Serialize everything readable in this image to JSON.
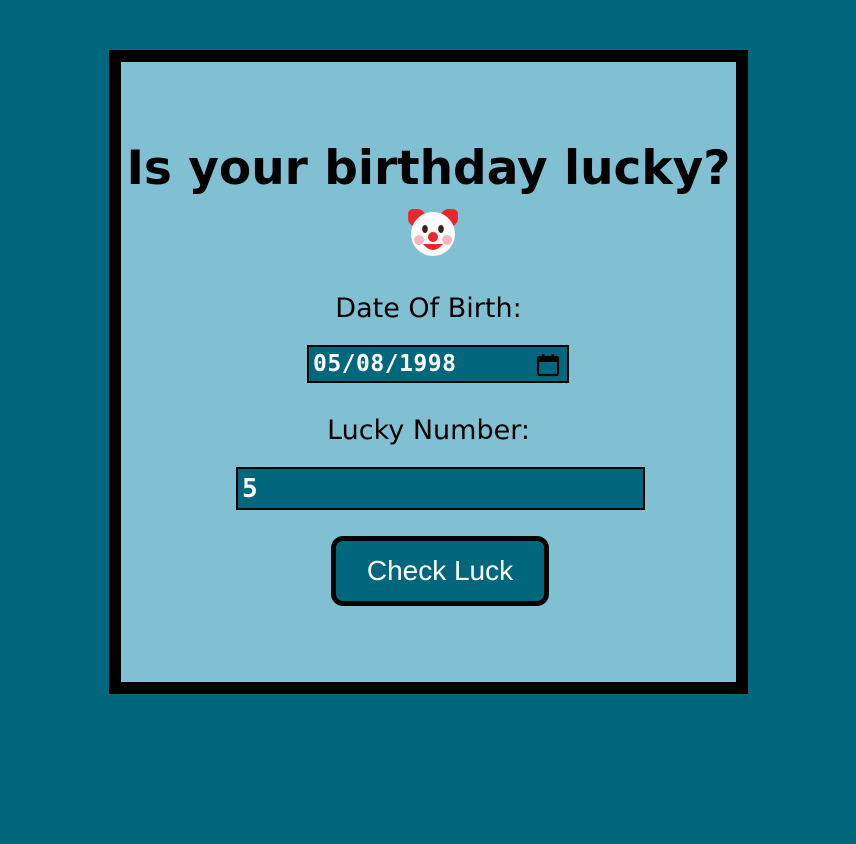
{
  "page": {
    "title": "Is your birthday lucky?",
    "title_icon": "clown-face-icon"
  },
  "form": {
    "dob_label": "Date Of Birth:",
    "dob_value": "05/08/1998",
    "dob_icon": "calendar-icon",
    "lucky_label": "Lucky Number:",
    "lucky_value": "5",
    "submit_label": "Check Luck"
  },
  "colors": {
    "page_background": "#00677d",
    "card_background": "#80c0d2",
    "card_border": "#000000",
    "field_background": "#00677d",
    "field_text": "#ffffff",
    "button_background": "#00677d",
    "button_text": "#ffffff"
  }
}
